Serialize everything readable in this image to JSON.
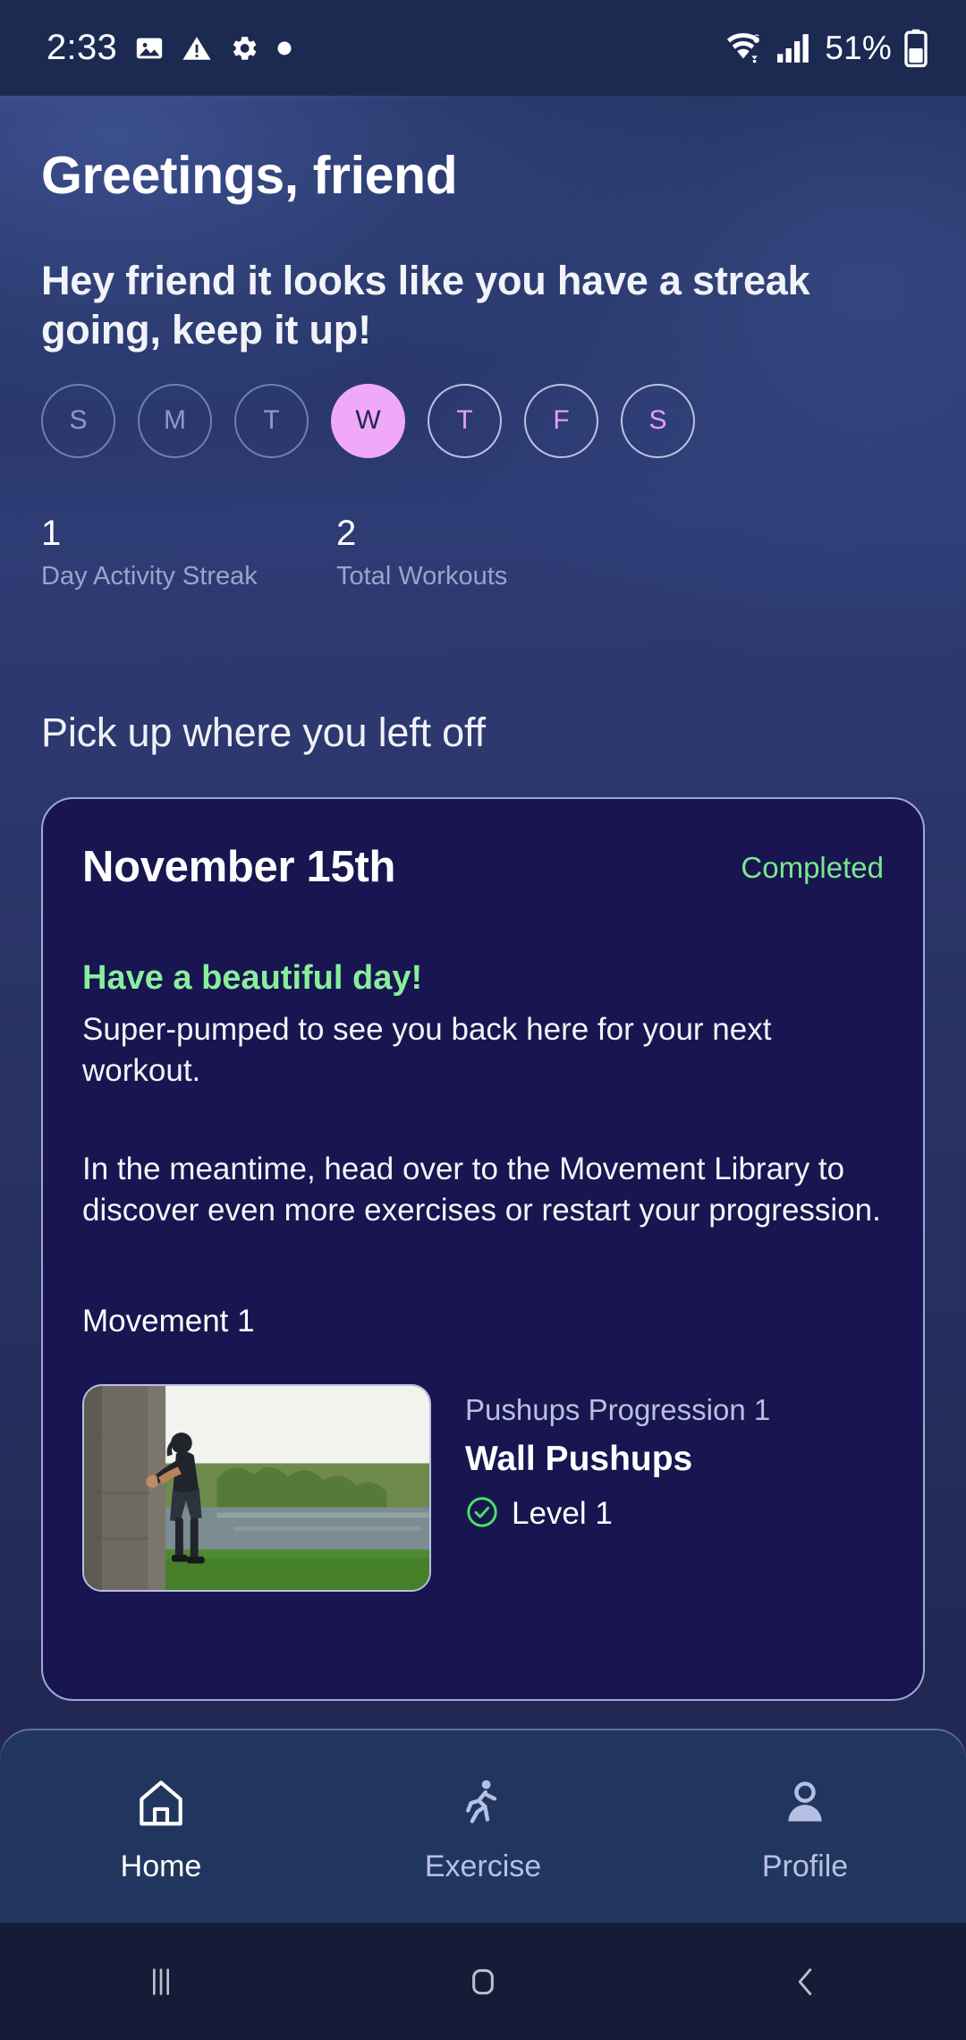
{
  "status_bar": {
    "time": "2:33",
    "left_icons": [
      "image-icon",
      "warning-icon",
      "gear-icon",
      "dot-icon"
    ],
    "wifi_label": "6",
    "battery_percent": "51%",
    "right_icons": [
      "wifi-icon",
      "signal-icon",
      "battery-icon"
    ]
  },
  "header": {
    "greeting": "Greetings, friend",
    "streak_message": "Hey friend it looks like you have a streak going, keep it up!"
  },
  "week": {
    "days": [
      {
        "label": "S",
        "state": "past"
      },
      {
        "label": "M",
        "state": "past"
      },
      {
        "label": "T",
        "state": "past"
      },
      {
        "label": "W",
        "state": "active"
      },
      {
        "label": "T",
        "state": "future"
      },
      {
        "label": "F",
        "state": "future"
      },
      {
        "label": "S",
        "state": "future"
      }
    ],
    "active_color": "#efa8fb"
  },
  "stats": [
    {
      "value": "1",
      "label": "Day Activity Streak"
    },
    {
      "value": "2",
      "label": "Total Workouts"
    }
  ],
  "section": {
    "title": "Pick up where you left off"
  },
  "workout_card": {
    "date": "November 15th",
    "status": "Completed",
    "status_color": "#79e88d",
    "heading": "Have a beautiful day!",
    "heading_color": "#87ef9c",
    "paragraph_1": "Super-pumped to see you back here for your next workout.",
    "paragraph_2": "In the meantime, head over to the Movement Library to discover even more exercises or restart your progression.",
    "movement_label": "Movement 1",
    "movement": {
      "progression": "Pushups Progression 1",
      "name": "Wall Pushups",
      "level": "Level 1",
      "level_icon": "check-circle-icon",
      "thumbnail_alt": "person doing wall pushups outdoors by a lake"
    }
  },
  "bottom_nav": {
    "items": [
      {
        "label": "Home",
        "icon": "home-icon",
        "active": true
      },
      {
        "label": "Exercise",
        "icon": "running-person-icon",
        "active": false
      },
      {
        "label": "Profile",
        "icon": "person-icon",
        "active": false
      }
    ]
  },
  "system_nav": {
    "buttons": [
      {
        "name": "recents-button",
        "icon": "recents-icon"
      },
      {
        "name": "home-button",
        "icon": "home-square-icon"
      },
      {
        "name": "back-button",
        "icon": "back-chevron-icon"
      }
    ]
  }
}
